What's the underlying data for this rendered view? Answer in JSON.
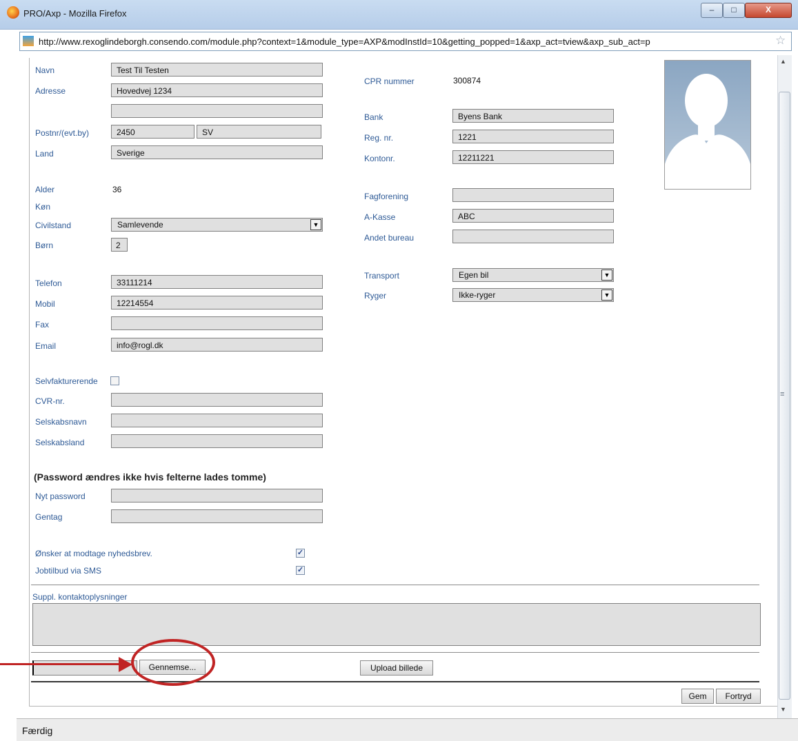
{
  "window": {
    "title": "PRO/Axp - Mozilla Firefox",
    "url": "http://www.rexoglindeborgh.consendo.com/module.php?context=1&module_type=AXP&modInstId=10&getting_popped=1&axp_act=tview&axp_sub_act=p",
    "status": "Færdig",
    "controls": {
      "minimize": "–",
      "maximize": "□",
      "close": "X"
    }
  },
  "left": {
    "navn": {
      "label": "Navn",
      "value": "Test Til Testen"
    },
    "adresse": {
      "label": "Adresse",
      "value": "Hovedvej 1234",
      "value2": ""
    },
    "postnr": {
      "label": "Postnr/(evt.by)",
      "zip": "2450",
      "city": "SV"
    },
    "land": {
      "label": "Land",
      "value": "Sverige"
    },
    "alder": {
      "label": "Alder",
      "value": "36"
    },
    "koen": {
      "label": "Køn"
    },
    "civilstand": {
      "label": "Civilstand",
      "value": "Samlevende"
    },
    "boern": {
      "label": "Børn",
      "value": "2"
    },
    "telefon": {
      "label": "Telefon",
      "value": "33111214"
    },
    "mobil": {
      "label": "Mobil",
      "value": "12214554"
    },
    "fax": {
      "label": "Fax",
      "value": ""
    },
    "email": {
      "label": "Email",
      "value": "info@rogl.dk"
    },
    "selvfakturerende": {
      "label": "Selvfakturerende",
      "checked": false
    },
    "cvr": {
      "label": "CVR-nr.",
      "value": ""
    },
    "selskabsnavn": {
      "label": "Selskabsnavn",
      "value": ""
    },
    "selskabsland": {
      "label": "Selskabsland",
      "value": ""
    },
    "password_note": "(Password ændres ikke hvis felterne lades tomme)",
    "nyt_password": {
      "label": "Nyt password",
      "value": ""
    },
    "gentag": {
      "label": "Gentag",
      "value": ""
    },
    "nyhedsbrev": {
      "label": "Ønsker at modtage nyhedsbrev.",
      "checked": true
    },
    "sms": {
      "label": "Jobtilbud via SMS",
      "checked": true
    }
  },
  "right": {
    "cpr": {
      "label": "CPR nummer",
      "value": "300874"
    },
    "bank": {
      "label": "Bank",
      "value": "Byens Bank"
    },
    "reg": {
      "label": "Reg. nr.",
      "value": "1221"
    },
    "konto": {
      "label": "Kontonr.",
      "value": "12211221"
    },
    "fagforening": {
      "label": "Fagforening",
      "value": ""
    },
    "akasse": {
      "label": "A-Kasse",
      "value": "ABC"
    },
    "andet": {
      "label": "Andet bureau",
      "value": ""
    },
    "transport": {
      "label": "Transport",
      "value": "Egen bil"
    },
    "ryger": {
      "label": "Ryger",
      "value": "Ikke-ryger"
    }
  },
  "suppl": {
    "label": "Suppl. kontaktoplysninger",
    "value": ""
  },
  "upload": {
    "file_value": "",
    "browse_label": "Gennemse...",
    "upload_label": "Upload billede"
  },
  "actions": {
    "save_label": "Gem",
    "cancel_label": "Fortryd"
  },
  "colors": {
    "label": "#2e5a96",
    "field": "#e0e0e0",
    "annotation": "#c02424"
  },
  "icons": {
    "browser": "firefox-icon",
    "site": "site-favicon-icon",
    "bookmark": "star-icon",
    "dropdown": "chevron-down-icon",
    "check": "checkmark-icon"
  }
}
